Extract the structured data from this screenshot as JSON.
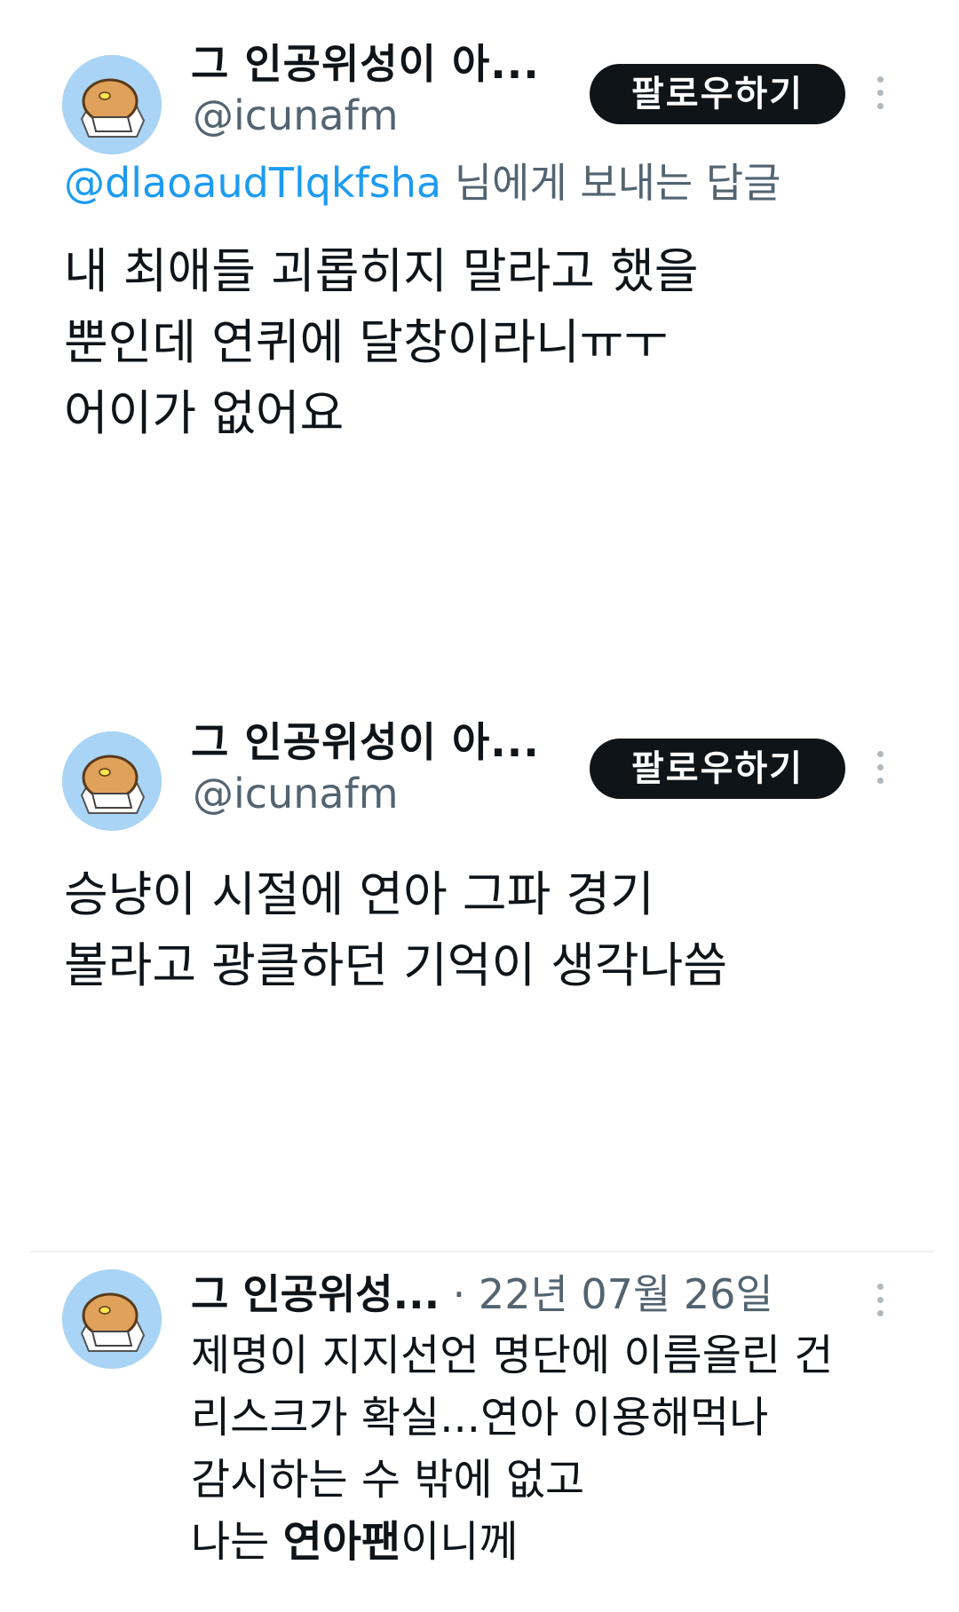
{
  "tweets": [
    {
      "name": "그 인공위성이 아...",
      "handle": "@icunafm",
      "follow_label": "팔로우하기",
      "reply_mention": "@dlaoaudTlqkfsha",
      "reply_suffix": " 님에게 보내는 답글",
      "lines": [
        "내 최애들 괴롭히지 말라고 했을",
        "뿐인데 연퀴에 달창이라니ㅠㅜ",
        "어이가 없어요"
      ]
    },
    {
      "name": "그 인공위성이 아...",
      "handle": "@icunafm",
      "follow_label": "팔로우하기",
      "lines": [
        "승냥이 시절에 연아 그파 경기",
        "볼라고 광클하던 기억이 생각나씀"
      ]
    },
    {
      "name": "그 인공위성...",
      "separator": " · ",
      "date": "22년 07월 26일",
      "lines": [
        "제명이 지지선언 명단에 이름올린 건",
        "리스크가 확실...연아 이용해먹나",
        "감시하는 수 밖에 없고"
      ],
      "last_line_prefix": "나는 ",
      "last_line_bold": "연아팬",
      "last_line_suffix": "이니께"
    }
  ],
  "colors": {
    "link": "#1d9bf0",
    "muted": "#536471",
    "button": "#0f1419",
    "avatar_bg": "#a9d4f5"
  },
  "icons": {
    "avatar": "bread-character-avatar",
    "more": "more-vertical-icon"
  }
}
